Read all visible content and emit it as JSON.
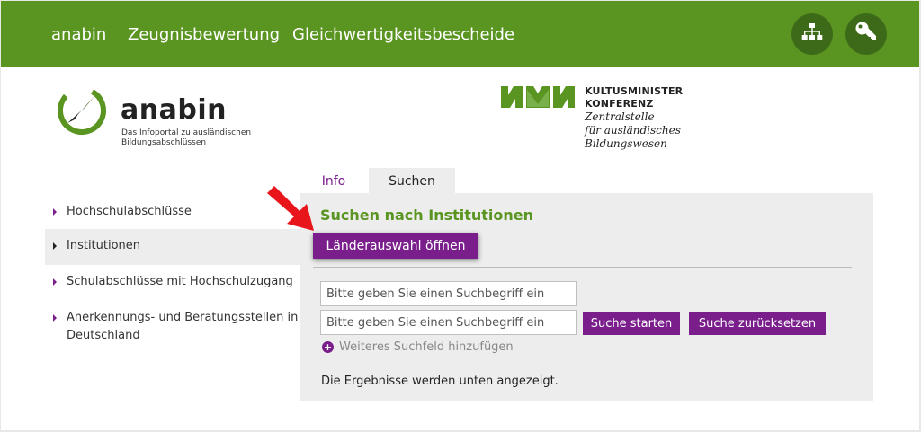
{
  "topnav": {
    "links": [
      "anabin",
      "Zeugnisbewertung",
      "Gleichwertigkeitsbescheide"
    ],
    "icons": [
      "sitemap-icon",
      "key-icon"
    ],
    "bg_color": "#5a9421",
    "icon_bg_color": "#3d6a18"
  },
  "logo_anabin": {
    "wordmark": "anabin",
    "subtitle_line1": "Das Infoportal zu ausländischen",
    "subtitle_line2": "Bildungsabschlüssen"
  },
  "logo_kmk": {
    "title_line1": "KULTUSMINISTER",
    "title_line2": "KONFERENZ",
    "italic_lines": [
      "Zentralstelle",
      "für ausländisches",
      "Bildungswesen"
    ],
    "mark_color": "#5a9421"
  },
  "tabs": [
    {
      "label": "Info",
      "active": false
    },
    {
      "label": "Suchen",
      "active": true
    }
  ],
  "sidebar": {
    "items": [
      {
        "label_lines": [
          "Hochschulabschlüsse"
        ],
        "active": false
      },
      {
        "label_lines": [
          "Institutionen"
        ],
        "active": true
      },
      {
        "label_lines": [
          "Schulabschlüsse mit Hochschulzugang"
        ],
        "active": false
      },
      {
        "label_lines": [
          "Anerkennungs- und Beratungsstellen in",
          "Deutschland"
        ],
        "active": false
      }
    ]
  },
  "search": {
    "title": "Suchen nach Institutionen",
    "country_button": "Länderauswahl öffnen",
    "input_placeholder": "Bitte geben Sie einen Suchbegriff ein",
    "input1_value": "",
    "input2_value": "",
    "start_button": "Suche starten",
    "reset_button": "Suche zurücksetzen",
    "add_field_label": "Weiteres Suchfeld hinzufügen",
    "results_text": "Die Ergebnisse werden unten angezeigt."
  },
  "colors": {
    "accent_purple": "#7a1e8c",
    "title_green": "#5a9421",
    "panel_bg": "#ededed",
    "annotation_arrow": "#e8151b"
  }
}
